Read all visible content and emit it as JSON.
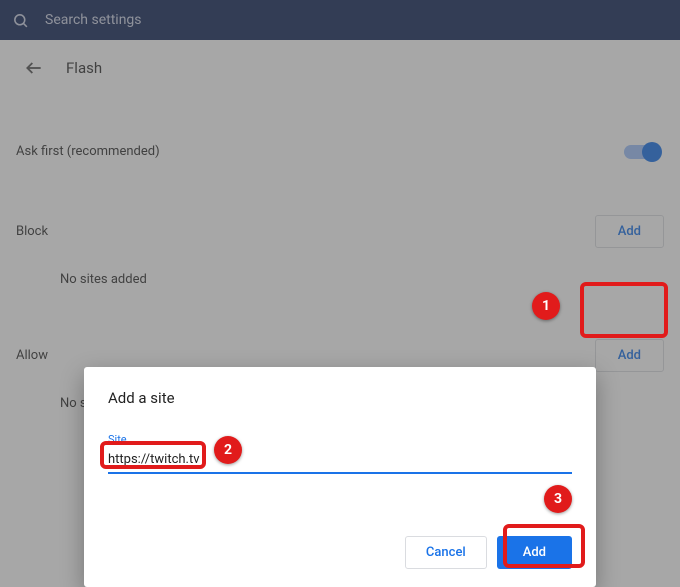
{
  "topbar": {
    "search_placeholder": "Search settings"
  },
  "header": {
    "title": "Flash"
  },
  "ask_first": {
    "label": "Ask first (recommended)",
    "enabled": true
  },
  "block": {
    "label": "Block",
    "add_label": "Add",
    "empty": "No sites added"
  },
  "allow": {
    "label": "Allow",
    "add_label": "Add",
    "empty": "No sites added"
  },
  "dialog": {
    "title": "Add a site",
    "field_label": "Site",
    "field_value": "https://twitch.tv",
    "cancel_label": "Cancel",
    "add_label": "Add"
  },
  "callouts": {
    "one": "1",
    "two": "2",
    "three": "3"
  }
}
